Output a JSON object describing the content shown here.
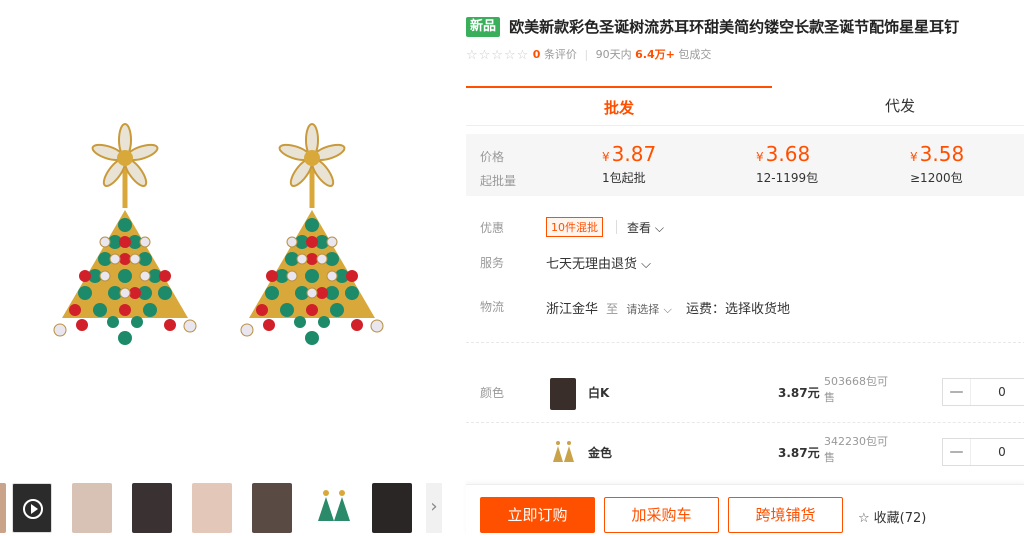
{
  "product": {
    "badge": "新品",
    "title": "欧美新款彩色圣诞树流苏耳环甜美简约镂空长款圣诞节配饰星星耳钉",
    "rating_stars": "☆☆☆☆☆",
    "review_count": "0",
    "review_label": "条评价",
    "period_label": "90天内",
    "sold_count": "6.4万+",
    "sold_label": "包成交"
  },
  "tabs": [
    {
      "label": "批发",
      "active": true
    },
    {
      "label": "代发",
      "active": false
    }
  ],
  "price_panel": {
    "price_label": "价格",
    "qty_label": "起批量",
    "currency": "¥",
    "tiers": [
      {
        "price": "3.87",
        "range": "1包起批"
      },
      {
        "price": "3.68",
        "range": "12-1199包"
      },
      {
        "price": "3.58",
        "range": "≥1200包"
      }
    ]
  },
  "promo": {
    "label": "优惠",
    "tag": "10件混批",
    "view_link": "查看 ⌵"
  },
  "service": {
    "label": "服务",
    "text": "七天无理由退货 ⌵"
  },
  "logistics": {
    "label": "物流",
    "origin": "浙江金华",
    "to": "至",
    "select": "请选择",
    "chevron": "⌵",
    "fee": "运费：选择收货地"
  },
  "sku": {
    "label": "颜色",
    "options": [
      {
        "name": "白K",
        "price": "3.87元",
        "stock": "503668包可售",
        "qty": "0",
        "minus": "—"
      },
      {
        "name": "金色",
        "price": "3.87元",
        "stock": "342230包可售",
        "qty": "0",
        "minus": "—"
      }
    ]
  },
  "actions": {
    "buy_now": "立即订购",
    "add_cart": "加采购车",
    "cross_border": "跨境铺货",
    "favorite_icon": "☆",
    "favorite": "收藏(72)"
  },
  "gallery": {
    "next_arrow": "›"
  },
  "colors": {
    "accent": "#ff5000",
    "badge_green": "#3aaf5b"
  }
}
